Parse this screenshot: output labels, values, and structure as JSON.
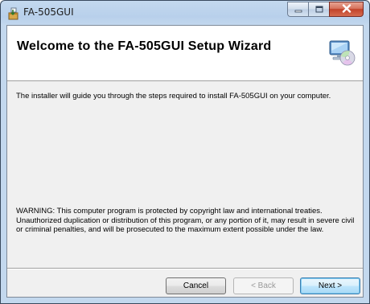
{
  "window": {
    "title": "FA-505GUI",
    "icon": "installer-icon",
    "controls": {
      "minimize": "minimize-icon",
      "maximize": "maximize-icon",
      "close": "close-icon"
    }
  },
  "banner": {
    "title": "Welcome to the FA-505GUI Setup Wizard",
    "icon": "computer-disc-icon"
  },
  "body": {
    "intro": "The installer will guide you through the steps required to install FA-505GUI on your computer.",
    "warning": "WARNING: This computer program is protected by copyright law and international treaties. Unauthorized duplication or distribution of this program, or any portion of it, may result in severe civil or criminal penalties, and will be prosecuted to the maximum extent possible under the law."
  },
  "buttons": {
    "cancel": "Cancel",
    "back": "< Back",
    "back_enabled": false,
    "next": "Next >"
  },
  "colors": {
    "title_bar": "#c4d9ef",
    "close_button": "#c2422a",
    "client_bg": "#f0f0f0",
    "next_button_focus": "#3c7fb1"
  }
}
